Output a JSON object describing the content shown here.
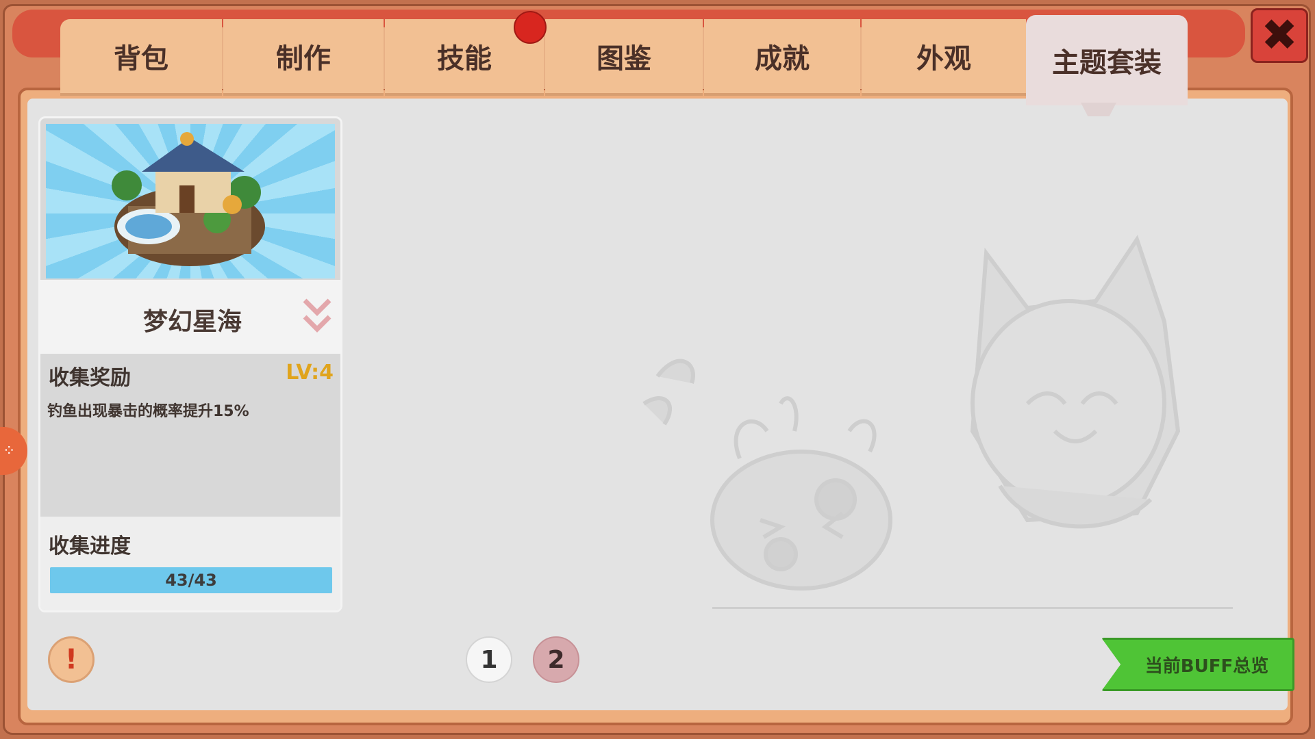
{
  "tabs": [
    {
      "label": "背包"
    },
    {
      "label": "制作"
    },
    {
      "label": "技能"
    },
    {
      "label": "图鉴"
    },
    {
      "label": "成就"
    },
    {
      "label": "外观"
    },
    {
      "label": "主题套装"
    }
  ],
  "active_tab": "主题套装",
  "close_button": {
    "label": "✖",
    "icon": "close-icon"
  },
  "card": {
    "name": "梦幻星海",
    "reward_label": "收集奖励",
    "level": "LV:4",
    "reward_desc": "钓鱼出现暴击的概率提升15%",
    "progress_label": "收集进度",
    "progress_text": "43/43",
    "progress_fraction": 1.0
  },
  "pagination": {
    "page1": "1",
    "page2": "2",
    "current": 2
  },
  "info_button": {
    "label": "!",
    "icon": "info-icon"
  },
  "buff_button": {
    "label": "当前BUFF总览"
  },
  "colors": {
    "accent_red": "#d8261f",
    "progress_blue": "#6ec8ec",
    "buff_green": "#4fc436",
    "level_gold": "#e0a41d"
  }
}
